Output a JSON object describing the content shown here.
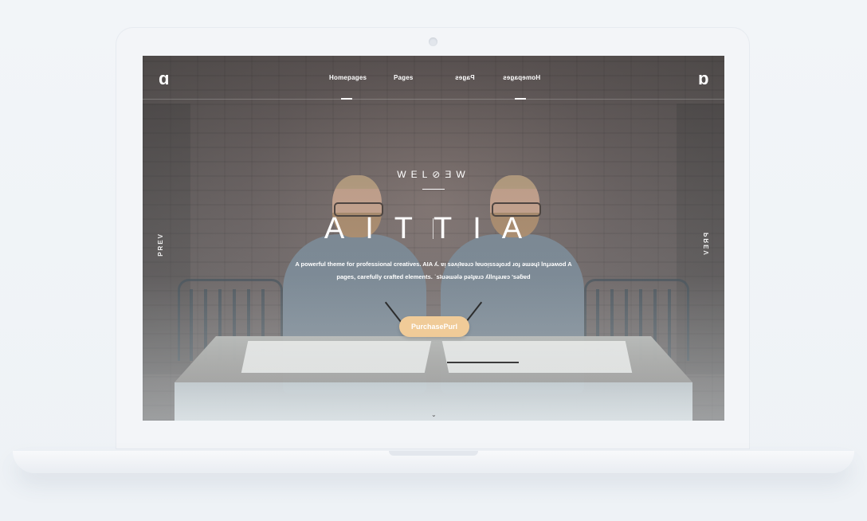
{
  "header": {
    "logo_left": "ɑ",
    "logo_right": "ɑ",
    "nav": [
      "Homepages",
      "Pages",
      "Pages",
      "Homepages"
    ]
  },
  "side": {
    "prev": "PREV"
  },
  "hero": {
    "welcome": "WEL⊘ƎW",
    "title_left": "AIT",
    "title_right": "TIA",
    "desc_line1": "A powerful theme for professional creatives. AIA ʎ. ɐᴉ sǝʌᴉʇɐǝɹɔ lɐuoᴉssǝɟoɹd ɹoɟ ǝɯǝɥʇ lnɟɹǝʍod A",
    "desc_line2": "pages, carefully crafted elements. ˙sʇuǝɯǝlǝ pǝʇɟɐɹɔ ʎllnɟǝɹɐɔ 'sǝƃɐd",
    "button": "PurchasePurl"
  }
}
